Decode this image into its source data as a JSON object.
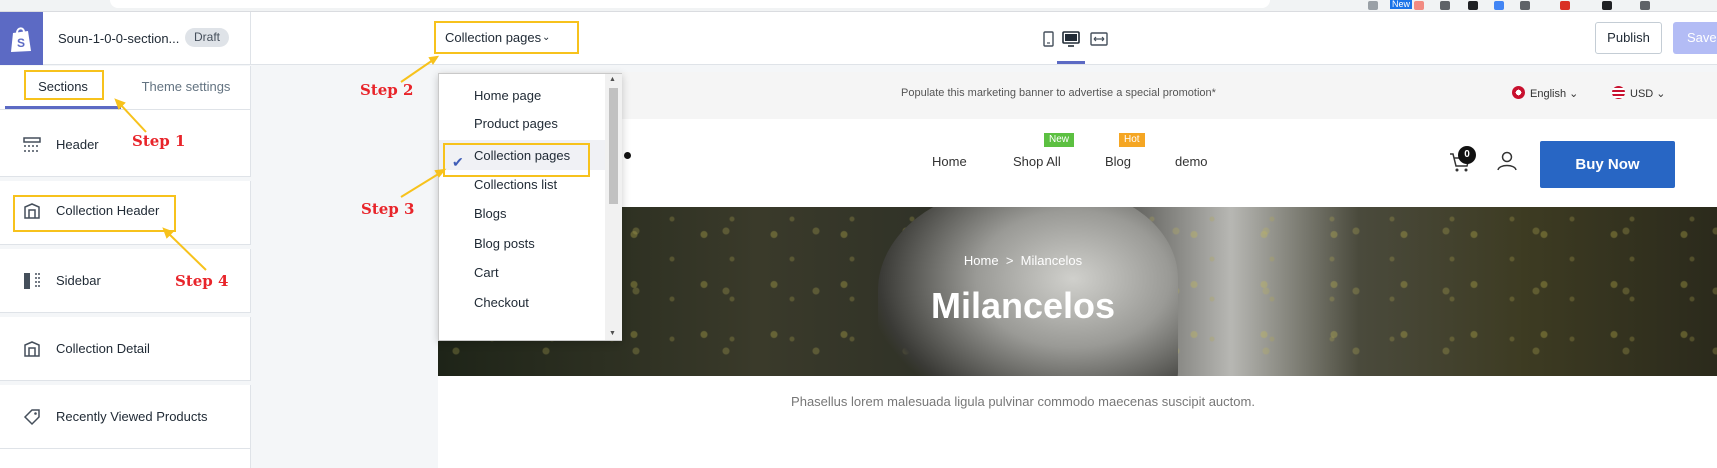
{
  "app": {
    "store_name": "Soun-1-0-0-section...",
    "status_badge": "Draft",
    "page_selector": "Collection pages",
    "publish_label": "Publish",
    "save_label": "Save",
    "accent_color": "#5c6ac4",
    "chrome_badge_new": "New"
  },
  "sidebar": {
    "tabs": [
      {
        "label": "Sections",
        "active": true
      },
      {
        "label": "Theme settings",
        "active": false
      }
    ],
    "sections": [
      {
        "label": "Header",
        "icon": "header-layout-icon"
      },
      {
        "label": "Collection Header",
        "icon": "collection-icon"
      },
      {
        "label": "Sidebar",
        "icon": "sidebar-layout-icon"
      },
      {
        "label": "Collection Detail",
        "icon": "collection-icon"
      },
      {
        "label": "Recently Viewed Products",
        "icon": "tag-icon"
      }
    ]
  },
  "annotations": {
    "step1": "Step 1",
    "step2": "Step 2",
    "step3": "Step 3",
    "step4": "Step 4",
    "highlight_color": "#f7c21c",
    "step_color": "#e8242a"
  },
  "dropdown": {
    "items": [
      "Home page",
      "Product pages",
      "Collection pages",
      "Collections list",
      "Blogs",
      "Blog posts",
      "Cart",
      "Checkout"
    ],
    "selected_index": 2
  },
  "preview": {
    "promo_text": "Populate this marketing banner to advertise a special promotion*",
    "language": "English",
    "currency": "USD",
    "nav": [
      "Home",
      "Shop All",
      "Blog",
      "demo"
    ],
    "badges": {
      "shop_all": "New",
      "blog": "Hot"
    },
    "cart_count": "0",
    "buy_label": "Buy Now",
    "breadcrumb_home": "Home",
    "breadcrumb_sep": ">",
    "breadcrumb_current": "Milancelos",
    "hero_title": "Milancelos",
    "description": "Phasellus lorem malesuada ligula pulvinar commodo maecenas suscipit auctom.",
    "buy_color": "#2866c4"
  }
}
